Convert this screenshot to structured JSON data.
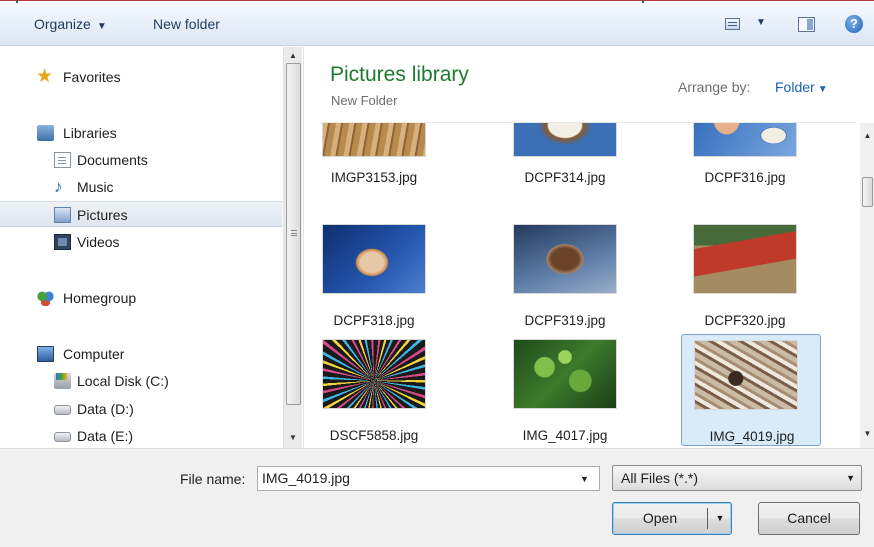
{
  "toolbar": {
    "organize_label": "Organize",
    "new_folder_label": "New folder",
    "views_icon": "views-icon",
    "preview_icon": "preview-pane-icon",
    "help_icon": "help-icon",
    "help_glyph": "?"
  },
  "nav": {
    "favorites": "Favorites",
    "libraries": "Libraries",
    "documents": "Documents",
    "music": "Music",
    "pictures": "Pictures",
    "videos": "Videos",
    "homegroup": "Homegroup",
    "computer": "Computer",
    "local_disk_c": "Local Disk (C:)",
    "data_d": "Data (D:)",
    "data_e": "Data (E:)",
    "selected": "Pictures"
  },
  "main": {
    "library_title": "Pictures library",
    "library_subtitle": "New Folder",
    "arrange_label": "Arrange by:",
    "arrange_value": "Folder"
  },
  "files": [
    {
      "name": "IMGP3153.jpg",
      "selected": false
    },
    {
      "name": "DCPF314.jpg",
      "selected": false
    },
    {
      "name": "DCPF316.jpg",
      "selected": false
    },
    {
      "name": "DCPF318.jpg",
      "selected": false
    },
    {
      "name": "DCPF319.jpg",
      "selected": false
    },
    {
      "name": "DCPF320.jpg",
      "selected": false
    },
    {
      "name": "DSCF5858.jpg",
      "selected": false
    },
    {
      "name": "IMG_4017.jpg",
      "selected": false
    },
    {
      "name": "IMG_4019.jpg",
      "selected": true
    }
  ],
  "bottom": {
    "file_name_label": "File name:",
    "file_name_value": "IMG_4019.jpg",
    "file_type_value": "All Files (*.*)",
    "open_label": "Open",
    "cancel_label": "Cancel"
  },
  "colors": {
    "library_title": "#1e7a2e",
    "link_blue": "#1e5fb8",
    "selection_fill": "#d9eaf9",
    "selection_border": "#7da2ce"
  }
}
